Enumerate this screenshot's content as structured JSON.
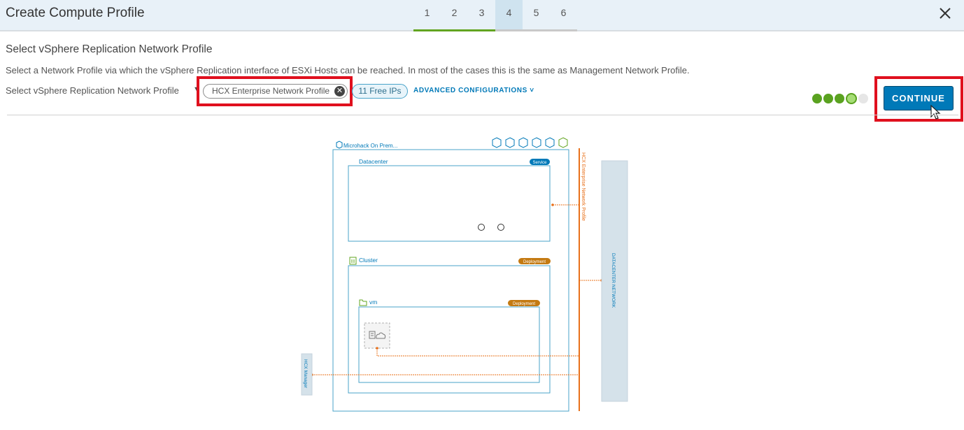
{
  "header": {
    "title": "Create Compute Profile",
    "steps": [
      "1",
      "2",
      "3",
      "4",
      "5",
      "6"
    ],
    "active_step": 4
  },
  "section": {
    "title": "Select vSphere Replication Network Profile",
    "description": "Select a Network Profile via which the vSphere Replication interface of ESXi Hosts can be reached. In most of the cases this is the same as Management Network Profile.",
    "select_label": "Select vSphere Replication Network Profile",
    "selected_profile": "HCX Enterprise Network Profile",
    "free_ips": "11 Free IPs",
    "advanced_label": "ADVANCED CONFIGURATIONS"
  },
  "progress": {
    "completed": 3,
    "current": 4,
    "total": 5
  },
  "continue_label": "CONTINUE",
  "diagram": {
    "site_name": "Microhack On Prem...",
    "datacenter_label": "Datacenter",
    "datacenter_badge": "Service",
    "cluster_label": "Cluster",
    "cluster_badge": "Deployment",
    "vm_label": "vm",
    "vm_badge": "Deployment",
    "network_profile_label": "HCX Enterprise Network Profile",
    "datacenter_network_label": "DATACENTER NETWORK",
    "hcx_manager_label": "HCX Manager"
  },
  "colors": {
    "accent": "#0079b8",
    "success": "#62a420",
    "highlight": "#e0101e",
    "network_line": "#e8701a",
    "badge_service": "#0079b8",
    "badge_deployment": "#c47a12"
  }
}
